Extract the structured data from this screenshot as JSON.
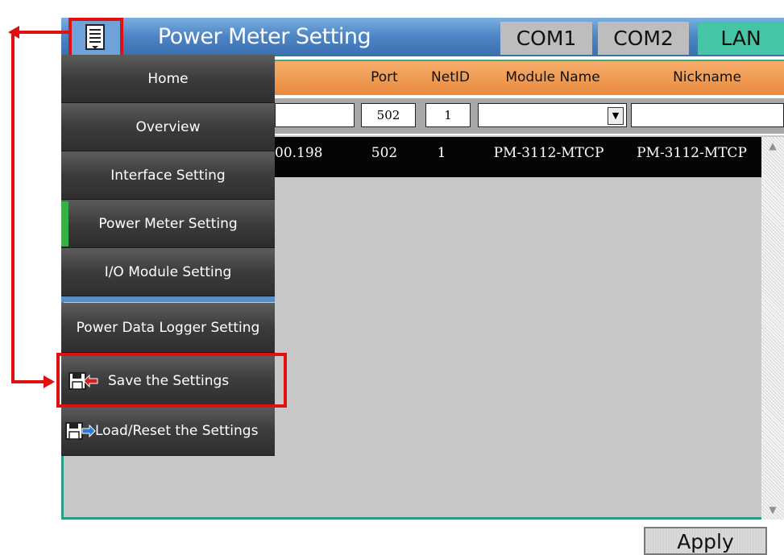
{
  "header": {
    "title": "Power Meter Setting",
    "tabs": [
      {
        "label": "COM1"
      },
      {
        "label": "COM2"
      },
      {
        "label": "LAN",
        "active": true
      }
    ],
    "menu_icon": "menu-list-icon"
  },
  "table": {
    "columns": [
      "Port",
      "NetID",
      "Module Name",
      "Nickname"
    ],
    "inputs": {
      "ip": "",
      "port": "502",
      "netid": "1",
      "module_name": "",
      "nickname": ""
    },
    "rows": [
      {
        "ip": "00.198",
        "port": "502",
        "netid": "1",
        "module_name": "PM-3112-MTCP",
        "nickname": "PM-3112-MTCP"
      }
    ]
  },
  "menu": {
    "items": [
      {
        "label": "Home"
      },
      {
        "label": "Overview"
      },
      {
        "label": "Interface Setting"
      },
      {
        "label": "Power Meter Setting",
        "active": true
      },
      {
        "label": "I/O Module Setting"
      },
      {
        "label": "Power Data Logger Setting"
      },
      {
        "label": "Save the Settings",
        "icon": "save-disk-icon"
      },
      {
        "label": "Load/Reset the Settings",
        "icon": "load-disk-icon"
      }
    ]
  },
  "apply_label": "Apply",
  "colors": {
    "highlight": "#e01010",
    "active_tab": "#45c5a6",
    "header_row": "#ea8a3e",
    "accent": "#38b048"
  }
}
